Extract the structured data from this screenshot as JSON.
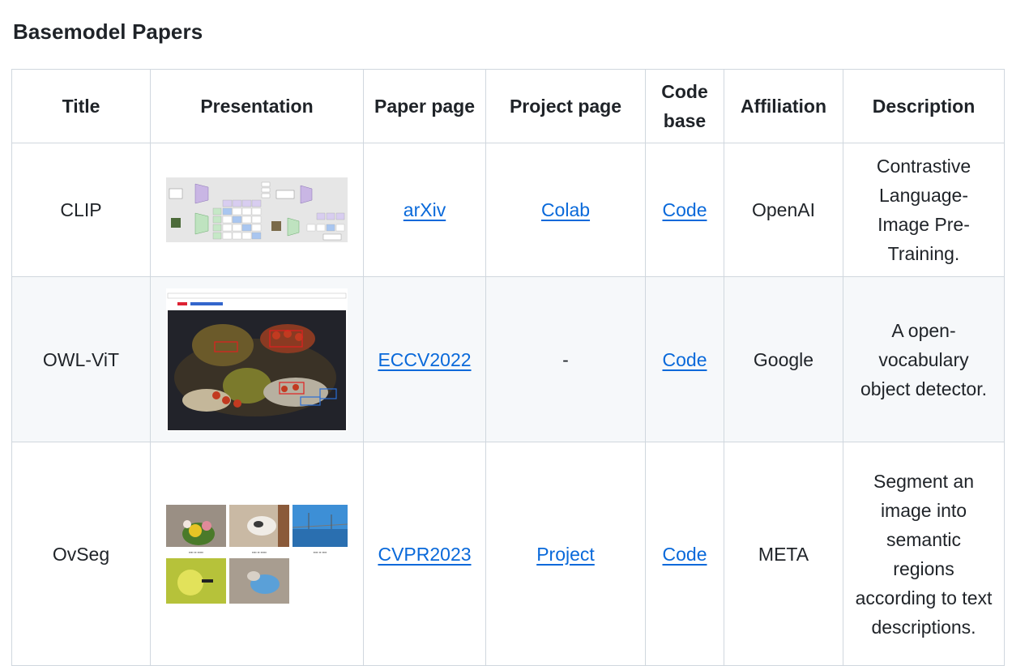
{
  "heading": "Basemodel Papers",
  "columns": [
    "Title",
    "Presentation",
    "Paper page",
    "Project page",
    "Code base",
    "Affiliation",
    "Description"
  ],
  "rows": [
    {
      "title": "CLIP",
      "paper": "arXiv",
      "project": "Colab",
      "code": "Code",
      "affiliation": "OpenAI",
      "description": "Contrastive Language-Image Pre-Training."
    },
    {
      "title": "OWL-ViT",
      "paper": "ECCV2022",
      "project": "-",
      "code": "Code",
      "affiliation": "Google",
      "description": "A open-vocabulary object detector."
    },
    {
      "title": "OvSeg",
      "paper": "CVPR2023",
      "project": "Project",
      "code": "Code",
      "affiliation": "META",
      "description": "Segment an image into semantic regions according to text descriptions."
    }
  ],
  "colors": {
    "link": "#0969da",
    "border": "#d0d7de",
    "alt_row": "#f6f8fa",
    "text": "#1f2328"
  }
}
